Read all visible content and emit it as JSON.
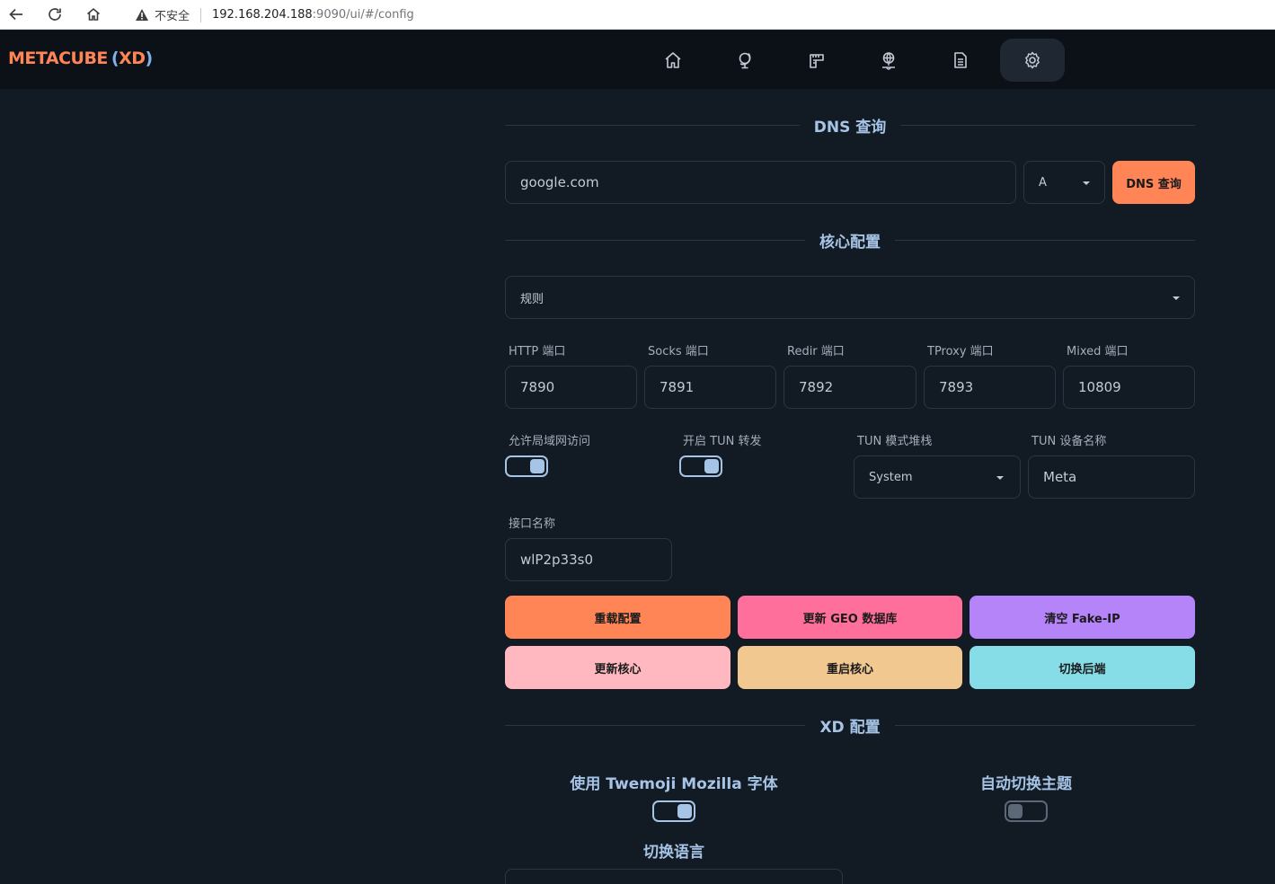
{
  "browser": {
    "security_text": "不安全",
    "url_host": "192.168.204.188",
    "url_rest": ":9090/ui/#/config"
  },
  "app": {
    "logo_main": "METACUBE",
    "logo_open": "(",
    "logo_xd": "XD",
    "logo_close": ")",
    "nav_icons": [
      "home-icon",
      "globe-stand-icon",
      "rules-icon",
      "network-globe-icon",
      "logs-icon",
      "gear-icon"
    ],
    "active_nav": "gear-icon"
  },
  "dns": {
    "title": "DNS 查询",
    "input_value": "google.com",
    "record_type": "A",
    "query_button": "DNS 查询"
  },
  "core": {
    "title": "核心配置",
    "mode": "规则",
    "ports": [
      {
        "label": "HTTP 端口",
        "value": "7890"
      },
      {
        "label": "Socks 端口",
        "value": "7891"
      },
      {
        "label": "Redir 端口",
        "value": "7892"
      },
      {
        "label": "TProxy 端口",
        "value": "7893"
      },
      {
        "label": "Mixed 端口",
        "value": "10809"
      }
    ],
    "allow_lan_label": "允许局域网访问",
    "allow_lan": true,
    "tun_label": "开启 TUN 转发",
    "tun": true,
    "tun_stack_label": "TUN 模式堆栈",
    "tun_stack": "System",
    "tun_device_label": "TUN 设备名称",
    "tun_device": "Meta",
    "interface_label": "接口名称",
    "interface": "wlP2p33s0",
    "buttons": [
      {
        "label": "重载配置",
        "color": "#ff8556"
      },
      {
        "label": "更新 GEO 数据库",
        "color": "#ff6f9c"
      },
      {
        "label": "清空 Fake-IP",
        "color": "#b484f8"
      },
      {
        "label": "更新核心",
        "color": "#ffb8c0"
      },
      {
        "label": "重启核心",
        "color": "#f0c890"
      },
      {
        "label": "切换后端",
        "color": "#86dde8"
      }
    ]
  },
  "xd": {
    "title": "XD 配置",
    "twemoji_label": "使用 Twemoji Mozilla 字体",
    "twemoji": true,
    "auto_theme_label": "自动切换主题",
    "auto_theme": false,
    "language_label": "切换语言"
  },
  "colors": {
    "accent": "#ff8556",
    "bg": "#121a24",
    "header_bg": "#0c1118"
  }
}
